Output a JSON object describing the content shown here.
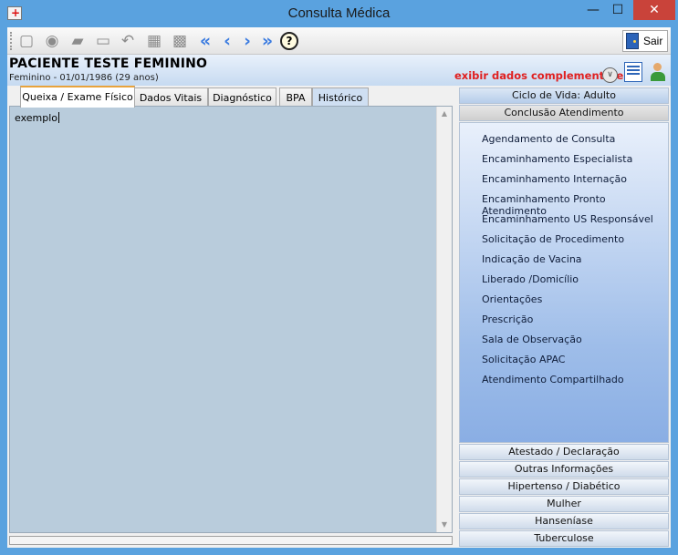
{
  "window": {
    "title": "Consulta Médica",
    "controls": {
      "minimize": "—",
      "maximize": "☐",
      "close": "✕"
    }
  },
  "toolbar": {
    "exit_label": "Sair",
    "help_glyph": "?"
  },
  "patient": {
    "name": "PACIENTE TESTE FEMININO",
    "info": "Feminino - 01/01/1986 (29 anos)",
    "more_link": "exibir dados complementares..."
  },
  "tabs": [
    {
      "label": "Queixa / Exame Físico"
    },
    {
      "label": "Dados Vitais"
    },
    {
      "label": "Diagnóstico"
    },
    {
      "label": "BPA"
    },
    {
      "label": "Histórico"
    }
  ],
  "editor": {
    "text": "exemplo"
  },
  "sidebar": {
    "life_cycle": "Ciclo de Vida: Adulto",
    "conclusion_header": "Conclusão Atendimento",
    "conclusion_items": [
      "Agendamento de Consulta",
      "Encaminhamento Especialista",
      "Encaminhamento Internação",
      "Encaminhamento Pronto Atendimento",
      "Encaminhamento US Responsável",
      "Solicitação de Procedimento",
      "Indicação de Vacina",
      "Liberado /Domicílio",
      "Orientações",
      "Prescrição",
      "Sala de Observação",
      "Solicitação APAC",
      "Atendimento Compartilhado"
    ],
    "sections": [
      "Atestado / Declaração",
      "Outras Informações",
      "Hipertenso / Diabético",
      "Mulher",
      "Hanseníase",
      "Tuberculose"
    ]
  },
  "colors": {
    "window_frame": "#5aa2df",
    "close_button": "#c9433a",
    "link_red": "#e02020",
    "editor_bg": "#b9ccdc",
    "toolbar_arrows": "#3a7be0"
  }
}
